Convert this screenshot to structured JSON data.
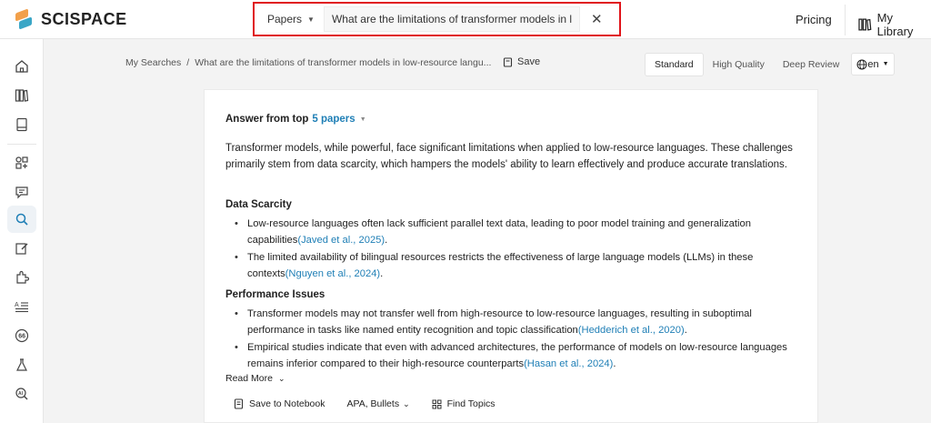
{
  "brand": {
    "name": "SCISPACE"
  },
  "search": {
    "scope_label": "Papers",
    "query": "What are the limitations of transformer models in low-resource languages?",
    "clear_icon": "close-icon"
  },
  "header": {
    "pricing": "Pricing",
    "library": "My Library"
  },
  "sidebar": {
    "icons": [
      "home-icon",
      "library-icon",
      "notebook-icon",
      "apps-add-icon",
      "chat-icon",
      "search-icon",
      "write-icon",
      "extension-icon",
      "paraphrase-icon",
      "citation-icon",
      "lab-icon",
      "ai-detect-icon"
    ]
  },
  "breadcrumb": {
    "root": "My Searches",
    "separator": "/",
    "current": "What are the limitations of transformer models in low-resource langu...",
    "save": "Save"
  },
  "modes": {
    "standard": "Standard",
    "high": "High Quality",
    "deep": "Deep Review"
  },
  "language": {
    "code": "en"
  },
  "answer": {
    "heading_prefix": "Answer from top",
    "heading_link": "5 papers",
    "intro": "Transformer models, while powerful, face significant limitations when applied to low-resource languages. These challenges primarily stem from data scarcity, which hampers the models' ability to learn effectively and produce accurate translations.",
    "sections": [
      {
        "title": "Data Scarcity",
        "bullets": [
          {
            "text": "Low-resource languages often lack sufficient parallel text data, leading to poor model training and generalization capabilities",
            "cite": "(Javed et al., 2025)",
            "tail": "."
          },
          {
            "text": "The limited availability of bilingual resources restricts the effectiveness of large language models (LLMs) in these contexts",
            "cite": "(Nguyen et al., 2024)",
            "tail": "."
          }
        ]
      },
      {
        "title": "Performance Issues",
        "bullets": [
          {
            "text": "Transformer models may not transfer well from high-resource to low-resource languages, resulting in suboptimal performance in tasks like named entity recognition and topic classification",
            "cite": "(Hedderich et al., 2020)",
            "tail": "."
          },
          {
            "text": "Empirical studies indicate that even with advanced architectures, the performance of models on low-resource languages remains inferior compared to their high-resource counterparts",
            "cite": "(Hasan et al., 2024)",
            "tail": "."
          }
        ]
      }
    ],
    "read_more": "Read More"
  },
  "actions": {
    "notebook": "Save to Notebook",
    "citation": "APA, Bullets",
    "topics": "Find Topics"
  },
  "colors": {
    "accent": "#1f7fb6",
    "highlight": "#e0141a"
  }
}
